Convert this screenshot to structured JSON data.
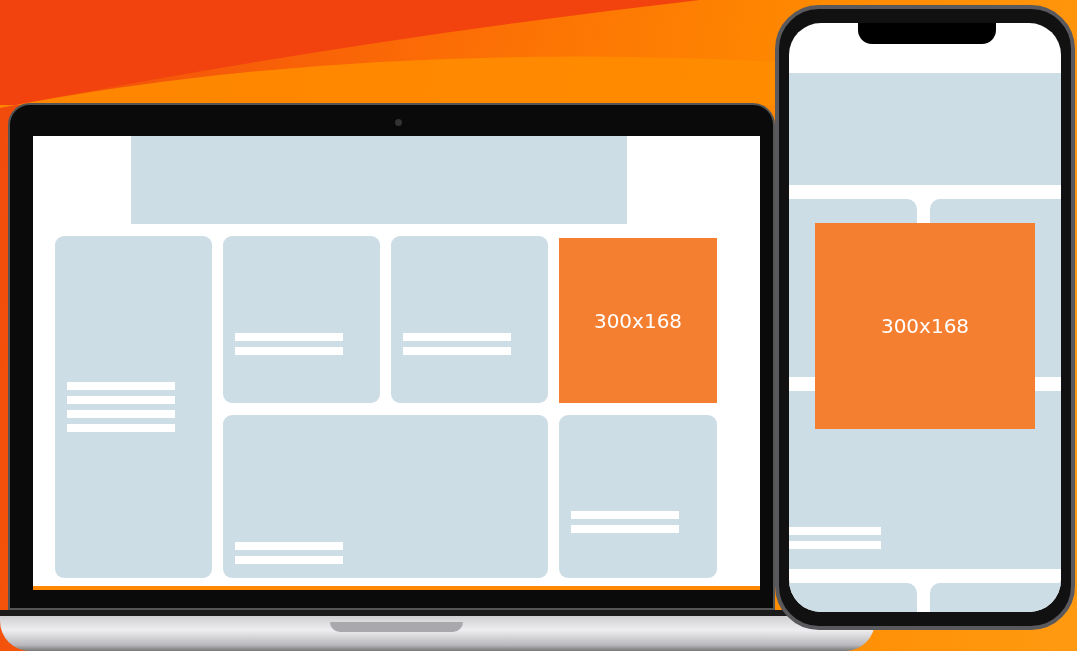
{
  "laptop": {
    "ad": {
      "label": "300x168"
    }
  },
  "phone": {
    "ad": {
      "label": "300x168"
    }
  }
}
